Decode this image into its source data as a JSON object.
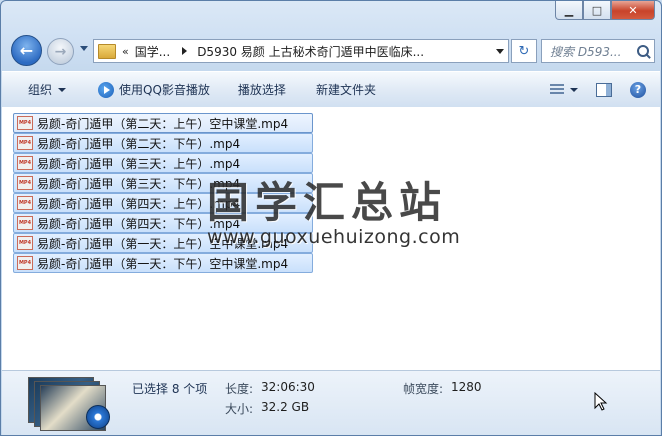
{
  "window": {
    "caption_buttons": {
      "minimize": "▁",
      "maximize": "□",
      "close": "✕"
    }
  },
  "nav": {
    "back_icon": "back-arrow-icon",
    "forward_icon": "forward-arrow-icon",
    "address": {
      "overflow": "«",
      "crumb1": "国学...",
      "crumb2": "D5930 易颜 上古秘术奇门遁甲中医临床..."
    },
    "search_placeholder": "搜索 D593..."
  },
  "toolbar": {
    "organize": "组织",
    "play_qq": "使用QQ影音播放",
    "play_selection": "播放选择",
    "new_folder": "新建文件夹"
  },
  "files": [
    "易颜-奇门遁甲（第二天：上午）空中课堂.mp4",
    "易颜-奇门遁甲（第二天：下午）.mp4",
    "易颜-奇门遁甲（第三天：上午）.mp4",
    "易颜-奇门遁甲（第三天：下午）.mp4",
    "易颜-奇门遁甲（第四天：上午）.mp4",
    "易颜-奇门遁甲（第四天：下午）.mp4",
    "易颜-奇门遁甲（第一天：上午）空中课堂.mp4",
    "易颜-奇门遁甲（第一天：下午）空中课堂.mp4"
  ],
  "file_icon_label": "MP4",
  "watermark": {
    "title": "国学汇总站",
    "url": "www.guoxuehuizong.com"
  },
  "details": {
    "selected": "已选择 8 个项",
    "duration_label": "长度:",
    "duration": "32:06:30",
    "size_label": "大小:",
    "size": "32.2 GB",
    "frame_width_label": "帧宽度:",
    "frame_width": "1280"
  }
}
